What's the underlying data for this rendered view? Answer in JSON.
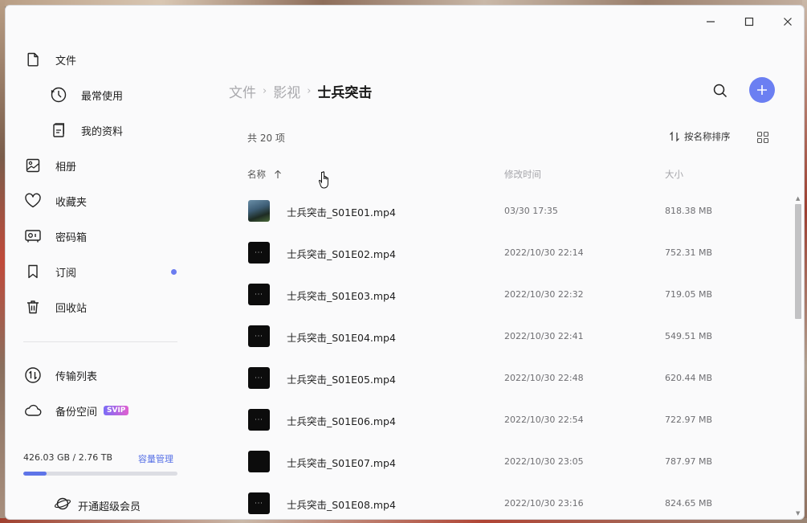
{
  "window": {
    "controls": [
      "minimize",
      "maximize",
      "close"
    ]
  },
  "sidebar": {
    "items": [
      {
        "label": "文件",
        "icon": "file-icon"
      },
      {
        "label": "最常使用",
        "icon": "clock-icon"
      },
      {
        "label": "我的资料",
        "icon": "document-icon"
      },
      {
        "label": "相册",
        "icon": "image-icon"
      },
      {
        "label": "收藏夹",
        "icon": "heart-icon"
      },
      {
        "label": "密码箱",
        "icon": "safe-icon"
      },
      {
        "label": "订阅",
        "icon": "bookmark-icon"
      },
      {
        "label": "回收站",
        "icon": "trash-icon"
      },
      {
        "label": "传输列表",
        "icon": "transfer-icon"
      },
      {
        "label": "备份空间",
        "icon": "cloud-icon",
        "badge": "SVIP"
      }
    ],
    "storage": {
      "text": "426.03 GB / 2.76 TB",
      "manage_label": "容量管理",
      "used_fraction": 0.15
    },
    "vip_button": "开通超级会员",
    "accent": "#6b7cf0"
  },
  "main": {
    "breadcrumb": [
      "文件",
      "影视"
    ],
    "current_folder": "士兵突击",
    "count_label": "共 20 项",
    "sort_label": "按名称排序",
    "columns": {
      "name": "名称",
      "time": "修改时间",
      "size": "大小"
    },
    "files": [
      {
        "name": "士兵突击_S01E01.mp4",
        "time": "03/30 17:35",
        "size": "818.38 MB",
        "thumb": "photo"
      },
      {
        "name": "士兵突击_S01E02.mp4",
        "time": "2022/10/30 22:14",
        "size": "752.31 MB",
        "thumb": "dots"
      },
      {
        "name": "士兵突击_S01E03.mp4",
        "time": "2022/10/30 22:32",
        "size": "719.05 MB",
        "thumb": "dots"
      },
      {
        "name": "士兵突击_S01E04.mp4",
        "time": "2022/10/30 22:41",
        "size": "549.51 MB",
        "thumb": "dots"
      },
      {
        "name": "士兵突击_S01E05.mp4",
        "time": "2022/10/30 22:48",
        "size": "620.44 MB",
        "thumb": "dots"
      },
      {
        "name": "士兵突击_S01E06.mp4",
        "time": "2022/10/30 22:54",
        "size": "722.97 MB",
        "thumb": "dots"
      },
      {
        "name": "士兵突击_S01E07.mp4",
        "time": "2022/10/30 23:05",
        "size": "787.97 MB",
        "thumb": "dark"
      },
      {
        "name": "士兵突击_S01E08.mp4",
        "time": "2022/10/30 23:16",
        "size": "824.65 MB",
        "thumb": "dots"
      }
    ],
    "add_button_color": "#6b7ff2"
  }
}
